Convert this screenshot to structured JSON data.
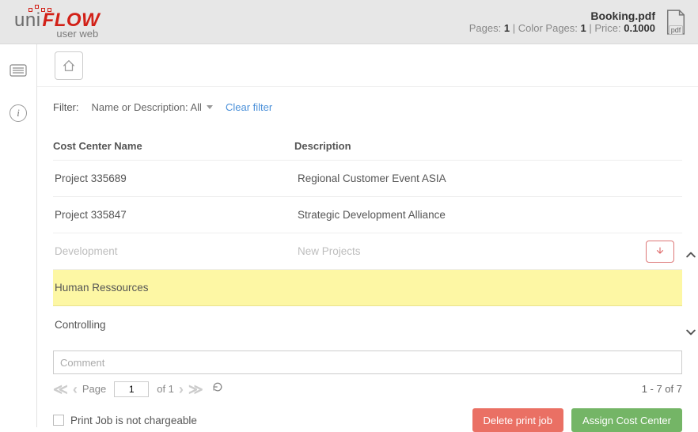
{
  "header": {
    "logo_uni": "uni",
    "logo_flow": "FLOW",
    "logo_sub": "user web",
    "doc_title": "Booking.pdf",
    "pages_label": "Pages:",
    "pages_value": "1",
    "color_pages_label": "Color Pages:",
    "color_pages_value": "1",
    "price_label": "Price:",
    "price_value": "0.1000",
    "file_ext": "pdf",
    "meta_sep": " | "
  },
  "leftrail": {
    "list_icon": "list",
    "info_icon": "i"
  },
  "toolbar": {
    "home_icon": "home"
  },
  "filter": {
    "label": "Filter:",
    "text": "Name or Description: All",
    "clear": "Clear filter"
  },
  "table": {
    "head_name": "Cost Center Name",
    "head_desc": "Description",
    "rows": [
      {
        "name": "Project 335689",
        "desc": "Regional Customer Event ASIA",
        "state": ""
      },
      {
        "name": "Project 335847",
        "desc": "Strategic Development Alliance",
        "state": ""
      },
      {
        "name": "Development",
        "desc": "New Projects",
        "state": "disabled",
        "action": true
      },
      {
        "name": "Human Ressources",
        "desc": "",
        "state": "highlight"
      },
      {
        "name": "Controlling",
        "desc": "",
        "state": ""
      }
    ]
  },
  "comment": {
    "placeholder": "Comment"
  },
  "pager": {
    "page_label": "Page",
    "page_value": "1",
    "of_label": "of 1",
    "range": "1 - 7 of 7"
  },
  "footer": {
    "chargeable_label": "Print Job is not chargeable",
    "delete_label": "Delete print job",
    "assign_label": "Assign Cost Center"
  }
}
